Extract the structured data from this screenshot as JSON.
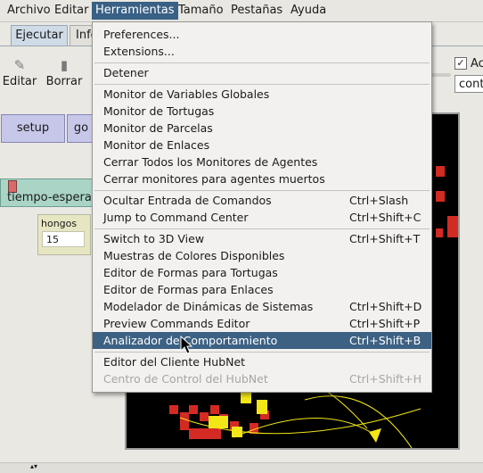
{
  "menubar": {
    "items": [
      "Archivo",
      "Editar",
      "Herramientas",
      "Tamaño",
      "Pestañas",
      "Ayuda"
    ]
  },
  "tabs": [
    "Ejecutar",
    "Info"
  ],
  "toolbar": {
    "editar": "Editar",
    "borrar": "Borrar",
    "checkbox_label": "Ac",
    "cont_field": "cont"
  },
  "interface": {
    "setup": "setup",
    "go": "go",
    "slider_label": "tiempo-espera",
    "monitor_label": "hongos",
    "monitor_value": "15"
  },
  "dropdown": {
    "items": [
      {
        "label": "Preferences...",
        "acc": ""
      },
      {
        "label": "Extensions...",
        "acc": ""
      },
      {
        "label": "Detener",
        "acc": ""
      },
      {
        "label": "Monitor de Variables Globales",
        "acc": ""
      },
      {
        "label": "Monitor de Tortugas",
        "acc": ""
      },
      {
        "label": "Monitor de Parcelas",
        "acc": ""
      },
      {
        "label": "Monitor de Enlaces",
        "acc": ""
      },
      {
        "label": "Cerrar Todos los Monitores de Agentes",
        "acc": ""
      },
      {
        "label": "Cerrar monitores para agentes muertos",
        "acc": ""
      },
      {
        "label": "Ocultar Entrada de Comandos",
        "acc": "Ctrl+Slash"
      },
      {
        "label": "Jump to Command Center",
        "acc": "Ctrl+Shift+C"
      },
      {
        "label": "Switch to 3D View",
        "acc": "Ctrl+Shift+T"
      },
      {
        "label": "Muestras de Colores Disponibles",
        "acc": ""
      },
      {
        "label": "Editor de Formas para Tortugas",
        "acc": ""
      },
      {
        "label": "Editor de Formas para Enlaces",
        "acc": ""
      },
      {
        "label": "Modelador de Dinámicas de Sistemas",
        "acc": "Ctrl+Shift+D"
      },
      {
        "label": "Preview Commands Editor",
        "acc": "Ctrl+Shift+P"
      },
      {
        "label": "Analizador de Comportamiento",
        "acc": "Ctrl+Shift+B"
      },
      {
        "label": "Editor del Cliente HubNet",
        "acc": ""
      },
      {
        "label": "Centro de Control del HubNet",
        "acc": "Ctrl+Shift+H"
      }
    ]
  },
  "colors": {
    "menu_highlight": "#3c6183",
    "button_bg": "#c7c7e9",
    "slider_bg": "#a9d4c6",
    "patch_red": "#d42a24",
    "turtle_yellow": "#f2e617"
  }
}
